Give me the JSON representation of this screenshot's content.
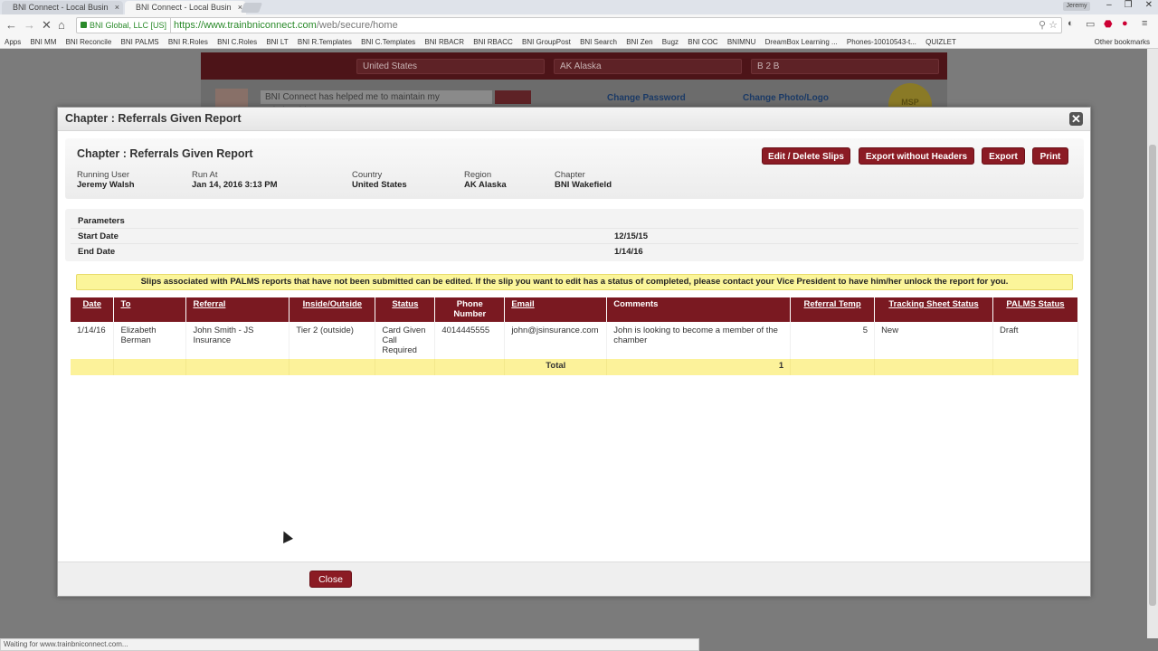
{
  "browser": {
    "tabs": [
      {
        "label": "BNI Connect - Local Busin"
      },
      {
        "label": "BNI Connect - Local Busin"
      }
    ],
    "user_badge": "Jeremy",
    "secure_label": "BNI Global, LLC [US]",
    "url_scheme": "https://",
    "url_host": "www.trainbniconnect.com",
    "url_path": "/web/secure/home",
    "bookmarks": [
      "Apps",
      "BNI MM",
      "BNI Reconcile",
      "BNI PALMS",
      "BNI R.Roles",
      "BNI C.Roles",
      "BNI LT",
      "BNI R.Templates",
      "BNI C.Templates",
      "BNI RBACR",
      "BNI RBACC",
      "BNI GroupPost",
      "BNI Search",
      "BNI Zen",
      "Bugz",
      "BNI COC",
      "BNIMNU",
      "DreamBox Learning ...",
      "Phones-10010543-t...",
      "QUIZLET"
    ],
    "other_bookmarks": "Other bookmarks",
    "status_text": "Waiting for www.trainbniconnect.com..."
  },
  "background": {
    "country_select": "United States",
    "region_select": "AK Alaska",
    "type_select": "B 2 B",
    "quote": "BNI Connect has helped me to maintain my relationships",
    "change_password": "Change Password",
    "change_photo": "Change Photo/Logo",
    "badge": "MSP"
  },
  "modal": {
    "title": "Chapter : Referrals Given Report",
    "report_title": "Chapter : Referrals Given Report",
    "buttons": {
      "edit": "Edit / Delete Slips",
      "export_no_headers": "Export without Headers",
      "export": "Export",
      "print": "Print"
    },
    "meta": [
      {
        "label": "Running User",
        "value": "Jeremy Walsh"
      },
      {
        "label": "Run At",
        "value": "Jan 14, 2016 3:13 PM"
      },
      {
        "label": "Country",
        "value": "United States"
      },
      {
        "label": "Region",
        "value": "AK Alaska"
      },
      {
        "label": "Chapter",
        "value": "BNI Wakefield"
      }
    ],
    "params": {
      "heading": "Parameters",
      "start_label": "Start Date",
      "start_value": "12/15/15",
      "end_label": "End Date",
      "end_value": "1/14/16"
    },
    "notice": "Slips associated with PALMS reports that have not been submitted can be edited. If the slip you want to edit has a status of completed, please contact your Vice President to have him/her unlock the report for you.",
    "columns": [
      "Date",
      "To",
      "Referral",
      "Inside/Outside",
      "Status",
      "Phone Number",
      "Email",
      "Comments",
      "Referral Temp",
      "Tracking Sheet Status",
      "PALMS Status"
    ],
    "rows": [
      {
        "date": "1/14/16",
        "to": "Elizabeth Berman",
        "referral": "John Smith - JS Insurance",
        "inside_outside": "Tier 2 (outside)",
        "status": "Card Given Call Required",
        "phone": "4014445555",
        "email": "john@jsinsurance.com",
        "comments": "John is looking to become a member of the chamber",
        "temp": "5",
        "tracking": "New",
        "palms": "Draft"
      }
    ],
    "total_label": "Total",
    "total_value": "1",
    "close_label": "Close"
  }
}
